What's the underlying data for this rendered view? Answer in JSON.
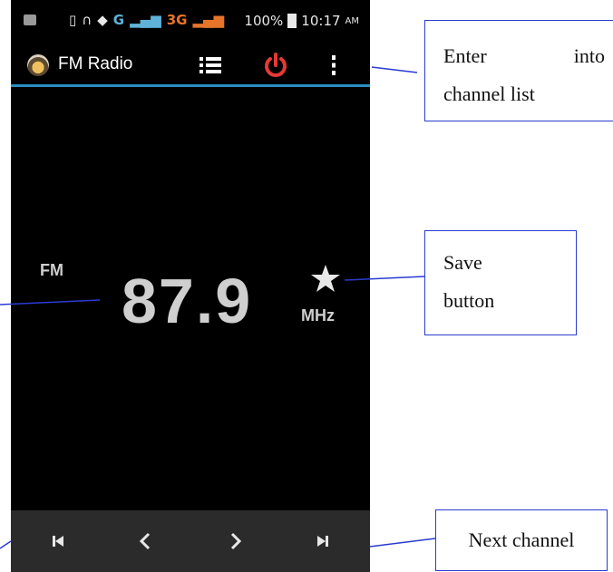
{
  "status_bar": {
    "network_g": "G",
    "network_3g": "3G",
    "battery_percent": "100%",
    "time": "10:17",
    "ampm": "AM"
  },
  "action_bar": {
    "title": "FM Radio",
    "icons": [
      "radio-app-icon",
      "channel-list-icon",
      "power-icon",
      "more-options-icon"
    ],
    "accent_color": "#2a8fc0",
    "power_color": "#e53935"
  },
  "tuner": {
    "band": "FM",
    "frequency": "87.9",
    "unit": "MHz"
  },
  "bottom_bar": {
    "icons": [
      "previous-channel-icon",
      "seek-back-icon",
      "seek-forward-icon",
      "next-channel-icon"
    ]
  },
  "annotations": {
    "channel_list": {
      "word1": "Enter",
      "word2": "into",
      "line2": "channel list"
    },
    "save": {
      "line1": "Save",
      "line2": "button"
    },
    "next": "Next channel"
  }
}
